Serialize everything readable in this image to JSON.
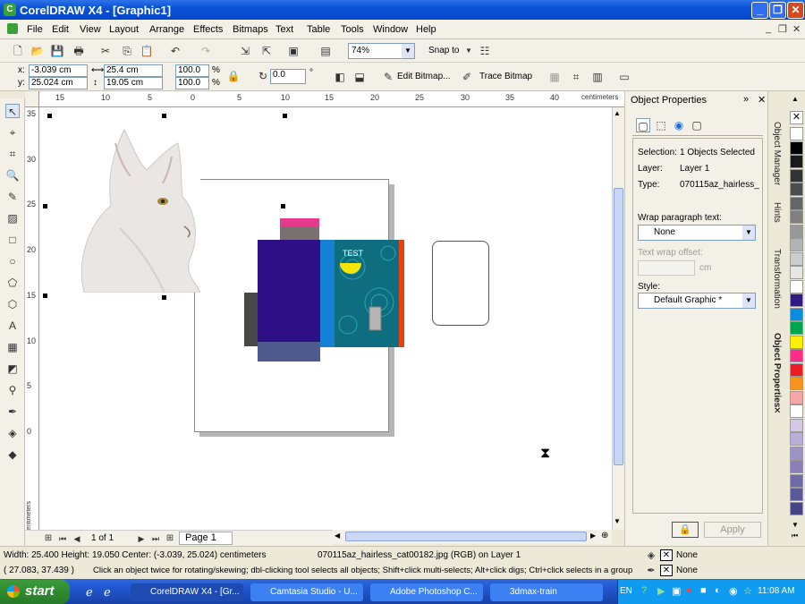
{
  "window": {
    "title": "CorelDRAW X4 - [Graphic1]"
  },
  "menu": [
    "File",
    "Edit",
    "View",
    "Layout",
    "Arrange",
    "Effects",
    "Bitmaps",
    "Text",
    "Table",
    "Tools",
    "Window",
    "Help"
  ],
  "toolbar": {
    "zoom": "74%",
    "snap_to": "Snap to"
  },
  "propbar": {
    "x": "-3.039 cm",
    "y": "25.024 cm",
    "width": "25.4 cm",
    "height": "19.05 cm",
    "scale_x": "100.0",
    "scale_y": "100.0",
    "pct": "%",
    "rotation": "0.0",
    "degree": "°",
    "edit_bitmap": "Edit Bitmap...",
    "trace_bitmap": "Trace Bitmap",
    "x_label": "x:",
    "y_label": "y:"
  },
  "ruler": {
    "unit": "centimeters",
    "h_ticks": [
      "15",
      "10",
      "5",
      "0",
      "5",
      "10",
      "15",
      "20",
      "25",
      "30",
      "35",
      "40"
    ],
    "v_ticks": [
      "35",
      "30",
      "25",
      "20",
      "15",
      "10",
      "5",
      "0"
    ]
  },
  "canvas": {
    "test_text": "TEST"
  },
  "pagebar": {
    "page_count": "1 of 1",
    "page_tab": "Page 1"
  },
  "docker": {
    "title": "Object Properties",
    "selection_label": "Selection:",
    "selection_value": "1 Objects Selected",
    "layer_label": "Layer:",
    "layer_value": "Layer 1",
    "type_label": "Type:",
    "type_value": "070115az_hairless_",
    "wrap_label": "Wrap paragraph text:",
    "wrap_value": "None",
    "offset_label": "Text wrap offset:",
    "offset_unit": "cm",
    "style_label": "Style:",
    "style_value": "Default Graphic *",
    "apply": "Apply"
  },
  "docker_tabs": [
    "Object Manager",
    "Hints",
    "Transformation",
    "Object Properties"
  ],
  "palette": [
    "#ffffff",
    "#000000",
    "#1a1a1a",
    "#333333",
    "#4d4d4d",
    "#666666",
    "#808080",
    "#999999",
    "#b3b3b3",
    "#cccccc",
    "#e6e6e6",
    "#ffffff",
    "#2e1b85",
    "#0a8de0",
    "#00a550",
    "#ffef00",
    "#ff2d8a",
    "#ec1c24",
    "#f7941d",
    "#f4a6a8",
    "#ffffff",
    "#d4c8e8",
    "#b8b0d8",
    "#9c94c8",
    "#8a7fb8",
    "#6e6aa8",
    "#5a5898",
    "#464488"
  ],
  "status": {
    "line1_left": "Width: 25.400  Height: 19.050  Center: (-3.039, 25.024)  centimeters",
    "line1_mid": "070115az_hairless_cat00182.jpg (RGB) on Layer 1",
    "line2_left": "( 27.083, 37.439 )",
    "line2_mid": "Click an object twice for rotating/skewing; dbl-clicking tool selects all objects; Shift+click multi-selects; Alt+click digs; Ctrl+click selects in a group",
    "fill": "None",
    "outline": "None"
  },
  "taskbar": {
    "start": "start",
    "tasks": [
      "CorelDRAW X4 - [Gr...",
      "Camtasia Studio - U...",
      "Adobe Photoshop C...",
      "3dmax-train"
    ],
    "lang": "EN",
    "clock": "11:08 AM"
  }
}
